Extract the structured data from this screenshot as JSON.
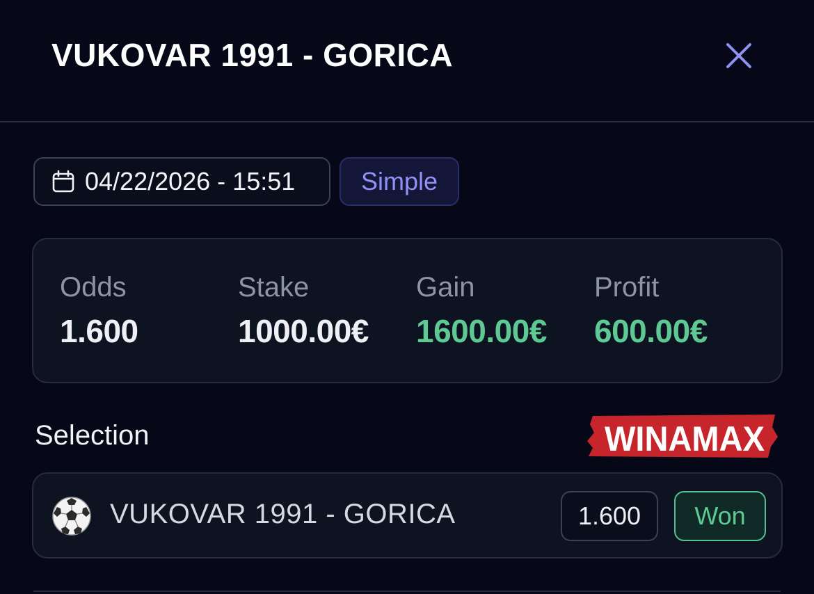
{
  "header": {
    "title": "VUKOVAR 1991 - GORICA",
    "close_icon": "close-icon"
  },
  "meta": {
    "datetime": "04/22/2026 - 15:51",
    "calendar_icon": "calendar-icon",
    "bet_type": "Simple"
  },
  "stats": {
    "odds": {
      "label": "Odds",
      "value": "1.600"
    },
    "stake": {
      "label": "Stake",
      "value": "1000.00€"
    },
    "gain": {
      "label": "Gain",
      "value": "1600.00€"
    },
    "profit": {
      "label": "Profit",
      "value": "600.00€"
    }
  },
  "selection": {
    "section_label": "Selection",
    "bookmaker": "WINAMAX",
    "items": [
      {
        "sport_icon": "soccer-ball-icon",
        "name": "VUKOVAR 1991 - GORICA",
        "odds": "1.600",
        "status": "Won"
      }
    ]
  },
  "colors": {
    "background": "#060817",
    "card": "#0e1322",
    "accent_purple": "#8f91f5",
    "won_green": "#5fc994",
    "brand_red": "#c6262b"
  }
}
